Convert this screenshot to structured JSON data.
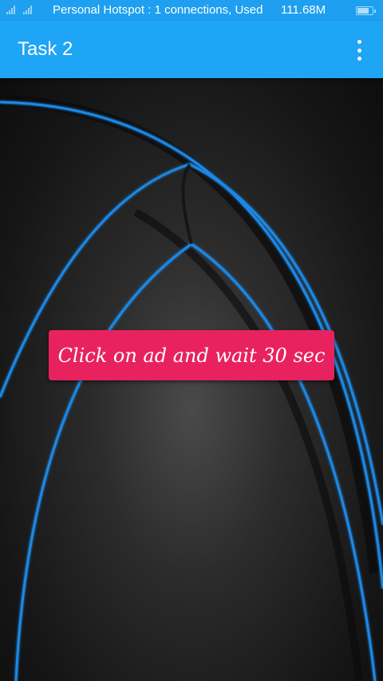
{
  "status_bar": {
    "hotspot_text": "Personal Hotspot : 1 connections, Used",
    "data_used": "111.68M",
    "battery_level": 0.8,
    "color": "#1e9ff0"
  },
  "app_bar": {
    "title": "Task 2",
    "menu_icon": "more-vert-icon",
    "color": "#1ea5f5"
  },
  "main": {
    "action_button_label": "Click on ad and wait 30 sec",
    "button_color": "#e8225f",
    "accent_line_color": "#1e88e5"
  }
}
